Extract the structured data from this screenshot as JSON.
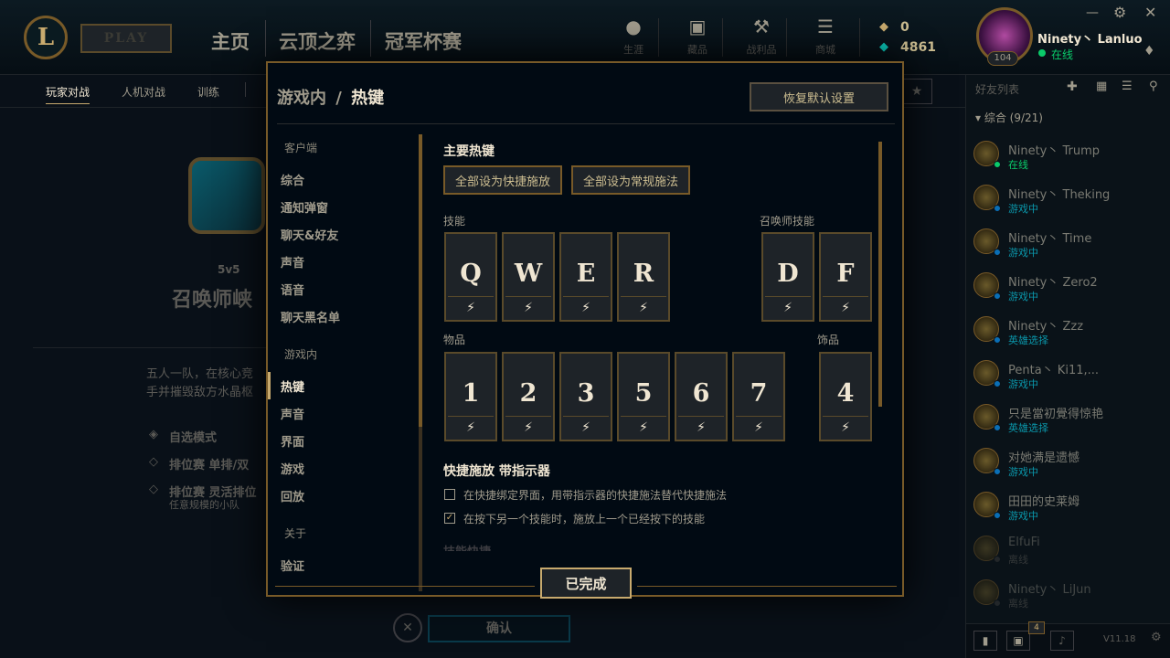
{
  "topbar": {
    "play_label": "PLAY",
    "tabs": [
      "主页",
      "云顶之弈",
      "冠军杯赛"
    ],
    "icons": [
      {
        "name": "profile-icon",
        "label": "生涯"
      },
      {
        "name": "collection-icon",
        "label": "藏品"
      },
      {
        "name": "loot-icon",
        "label": "战利品"
      },
      {
        "name": "store-icon",
        "label": "商城"
      }
    ],
    "currency_rp": "0",
    "currency_be": "4861",
    "username": "Ninety丶 Lanluo",
    "status": "在线",
    "level": "104"
  },
  "subbar": {
    "items": [
      "玩家对战",
      "人机对战",
      "训练"
    ]
  },
  "lobby": {
    "mode_small": "5v5",
    "mode_title": "召唤师峡",
    "desc1": "五人一队，在核心竞",
    "desc2": "手并摧毁敌方水晶枢",
    "opt1": "自选模式",
    "opt2": "排位赛 单排/双",
    "opt3": "排位赛 灵活排位",
    "opt3_sub": "任意规模的小队",
    "confirm": "确认"
  },
  "friends": {
    "title": "好友列表",
    "group": "综合 (9/21)",
    "list": [
      {
        "name": "Ninety丶 Trump",
        "status": "在线",
        "color": "#0acb6a"
      },
      {
        "name": "Ninety丶 Theking",
        "status": "游戏中",
        "color": "#0a6eb5"
      },
      {
        "name": "Ninety丶 Time",
        "status": "游戏中",
        "color": "#0a6eb5"
      },
      {
        "name": "Ninety丶 Zero2",
        "status": "游戏中",
        "color": "#0a6eb5"
      },
      {
        "name": "Ninety丶 Zzz",
        "status": "英雄选择",
        "color": "#0a6eb5"
      },
      {
        "name": "Penta丶 Ki11,...",
        "status": "游戏中",
        "color": "#0a6eb5"
      },
      {
        "name": "只是當初覺得惊艳",
        "status": "英雄选择",
        "color": "#0a6eb5"
      },
      {
        "name": "对她满是遗憾",
        "status": "游戏中",
        "color": "#0a6eb5"
      },
      {
        "name": "田田的史莱姆",
        "status": "游戏中",
        "color": "#0a6eb5"
      },
      {
        "name": "ElfuFi",
        "status": "离线",
        "color": "#3a3a3a"
      },
      {
        "name": "Ninety丶 LiJun",
        "status": "离线",
        "color": "#3a3a3a"
      }
    ],
    "footer_badge": "4",
    "version": "V11.18"
  },
  "modal": {
    "crumb_a": "游戏内",
    "crumb_sep": "/",
    "crumb_b": "热键",
    "reset": "恢复默认设置",
    "sec_client": "客户端",
    "client_items": [
      "综合",
      "通知弹窗",
      "聊天&好友",
      "声音",
      "语音",
      "聊天黑名单"
    ],
    "sec_ingame": "游戏内",
    "ingame_items": [
      "热键",
      "声音",
      "界面",
      "游戏",
      "回放"
    ],
    "sec_about": "关于",
    "about_items": [
      "验证"
    ],
    "main_title": "主要热键",
    "btn_quick": "全部设为快捷施放",
    "btn_normal": "全部设为常规施法",
    "skills_label": "技能",
    "summoner_label": "召唤师技能",
    "items_label": "物品",
    "trinket_label": "饰品",
    "skills": [
      "Q",
      "W",
      "E",
      "R"
    ],
    "summoner": [
      "D",
      "F"
    ],
    "items": [
      "1",
      "2",
      "3",
      "5",
      "6",
      "7"
    ],
    "trinket": [
      "4"
    ],
    "cast_glyph": "⚡",
    "indicator_title": "快捷施放 带指示器",
    "opt1": "在快捷绑定界面，用带指示器的快捷施法替代快捷施法",
    "opt2": "在按下另一个技能时，施放上一个已经按下的技能",
    "opt2_checked": true,
    "cut_title": "技能快捷",
    "done": "已完成"
  }
}
